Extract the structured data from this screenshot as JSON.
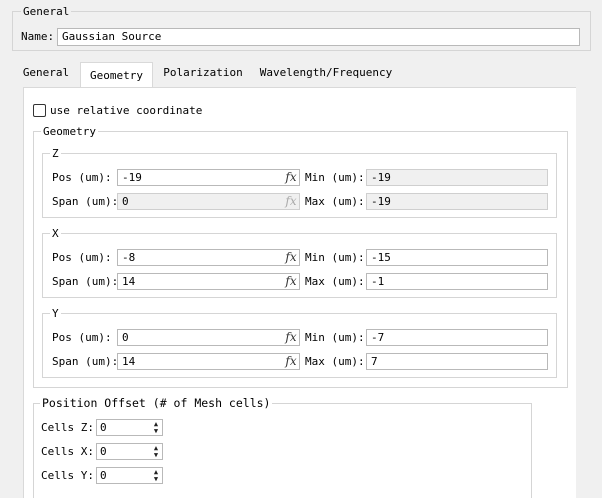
{
  "general_group": {
    "title": "General",
    "name_label": "Name:",
    "name_value": "Gaussian Source"
  },
  "tabs": [
    {
      "label": "General",
      "active": false
    },
    {
      "label": "Geometry",
      "active": true
    },
    {
      "label": "Polarization",
      "active": false
    },
    {
      "label": "Wavelength/Frequency",
      "active": false
    }
  ],
  "relative_coordinate": {
    "label": "use relative coordinate",
    "checked": false
  },
  "geometry": {
    "title": "Geometry",
    "z": {
      "title": "Z",
      "pos_label": "Pos (um):",
      "pos_value": "-19",
      "span_label": "Span (um):",
      "span_value": "0",
      "min_label": "Min (um):",
      "min_value": "-19",
      "max_label": "Max (um):",
      "max_value": "-19"
    },
    "x": {
      "title": "X",
      "pos_label": "Pos (um):",
      "pos_value": "-8",
      "span_label": "Span (um):",
      "span_value": "14",
      "min_label": "Min (um):",
      "min_value": "-15",
      "max_label": "Max (um):",
      "max_value": "-1"
    },
    "y": {
      "title": "Y",
      "pos_label": "Pos (um):",
      "pos_value": "0",
      "span_label": "Span (um):",
      "span_value": "14",
      "min_label": "Min (um):",
      "min_value": "-7",
      "max_label": "Max (um):",
      "max_value": "7"
    }
  },
  "offset": {
    "title": "Position Offset (# of Mesh cells)",
    "cells_z_label": "Cells Z:",
    "cells_z_value": "0",
    "cells_x_label": "Cells X:",
    "cells_x_value": "0",
    "cells_y_label": "Cells Y:",
    "cells_y_value": "0"
  },
  "icons": {
    "fx": "fx",
    "spin_up": "▲",
    "spin_down": "▼"
  }
}
